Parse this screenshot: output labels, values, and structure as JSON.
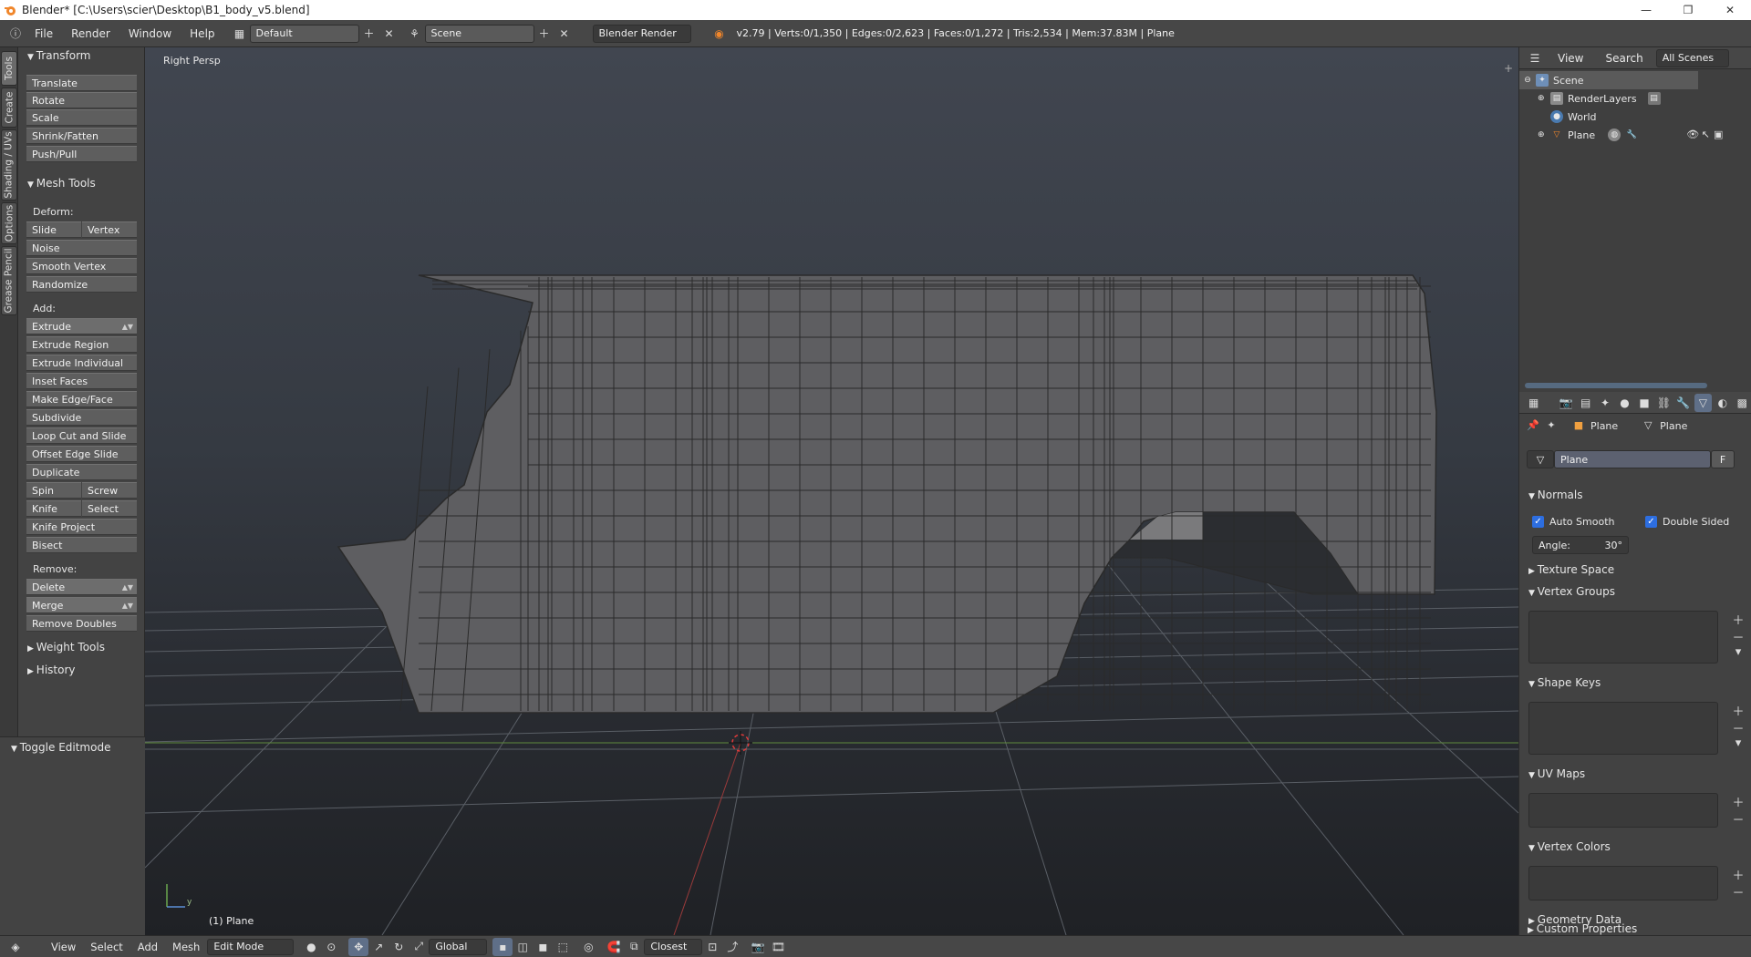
{
  "window": {
    "title": "Blender* [C:\\Users\\scier\\Desktop\\B1_body_v5.blend]"
  },
  "menu": {
    "items": [
      "File",
      "Render",
      "Window",
      "Help"
    ],
    "layout": "Default",
    "scene": "Scene",
    "engine": "Blender Render",
    "stats": "v2.79 | Verts:0/1,350 | Edges:0/2,623 | Faces:0/1,272 | Tris:2,534 | Mem:37.83M | Plane"
  },
  "left_tabs": [
    "Tools",
    "Create",
    "Shading / UVs",
    "Options",
    "Grease Pencil"
  ],
  "toolshelf": {
    "transform": {
      "header": "Transform",
      "buttons": [
        "Translate",
        "Rotate",
        "Scale",
        "Shrink/Fatten",
        "Push/Pull"
      ]
    },
    "mesh_tools": {
      "header": "Mesh Tools",
      "deform_label": "Deform:",
      "slide_edge": "Slide Edge",
      "vertex": "Vertex",
      "deform_buttons": [
        "Noise",
        "Smooth Vertex",
        "Randomize"
      ],
      "add_label": "Add:",
      "extrude": "Extrude",
      "add_buttons": [
        "Extrude Region",
        "Extrude Individual",
        "Inset Faces",
        "Make Edge/Face",
        "Subdivide",
        "Loop Cut and Slide",
        "Offset Edge Slide",
        "Duplicate"
      ],
      "spin": "Spin",
      "screw": "Screw",
      "knife": "Knife",
      "select": "Select",
      "knife_project": "Knife Project",
      "bisect": "Bisect",
      "remove_label": "Remove:",
      "delete": "Delete",
      "merge": "Merge",
      "remove_doubles": "Remove Doubles"
    },
    "weight_tools": "Weight Tools",
    "history": "History",
    "toggle_editmode": "Toggle Editmode"
  },
  "viewport": {
    "view_label": "Right Persp",
    "object_label": "(1) Plane",
    "axis_y": "y"
  },
  "bottombar": {
    "menus": [
      "View",
      "Select",
      "Add",
      "Mesh"
    ],
    "mode": "Edit Mode",
    "orientation": "Global",
    "snap": "Closest"
  },
  "outliner": {
    "view": "View",
    "search": "Search",
    "filter": "All Scenes",
    "rows": {
      "scene": "Scene",
      "renderlayers": "RenderLayers",
      "world": "World",
      "plane": "Plane"
    }
  },
  "properties": {
    "tab_object": "Plane",
    "tab_mesh": "Plane",
    "mesh_name": "Plane",
    "fake_user": "F",
    "normals": "Normals",
    "auto_smooth": "Auto Smooth",
    "double_sided": "Double Sided",
    "angle_label": "Angle:",
    "angle_value": "30°",
    "texture_space": "Texture Space",
    "vertex_groups": "Vertex Groups",
    "shape_keys": "Shape Keys",
    "uv_maps": "UV Maps",
    "vertex_colors": "Vertex Colors",
    "geometry_data": "Geometry Data",
    "custom_properties": "Custom Properties"
  },
  "colors": {
    "accent": "#2d6ee0",
    "bg": "#3d3d3d",
    "mesh": "#5e5e61"
  }
}
